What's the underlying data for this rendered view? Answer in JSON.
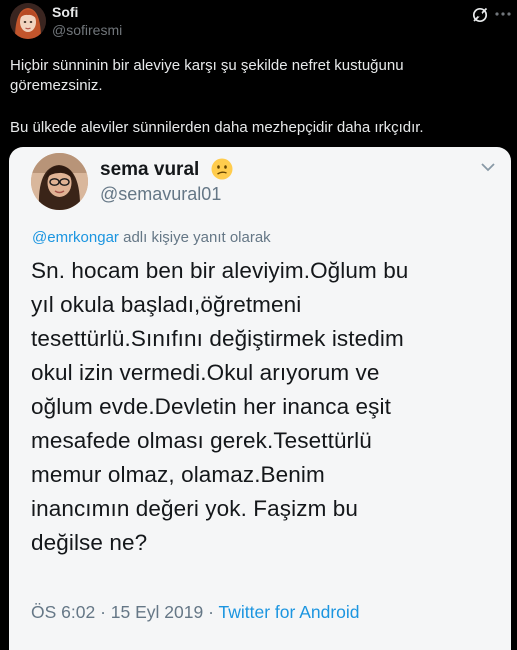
{
  "post": {
    "author_name": "Sofi",
    "author_handle": "@sofiresmi",
    "text_line_1": "Hiçbir sünninin bir aleviye karşı şu şekilde nefret kustuğunu",
    "text_line_2": "göremezsiniz.",
    "text_line_3": "Bu ülkede aleviler sünnilerden daha mezhepçidir daha ırkçıdır."
  },
  "quoted_tweet": {
    "display_name": "sema vural",
    "handle": "@semavural01",
    "reply_mention": "@emrkongar",
    "reply_suffix": "adlı kişiye yanıt olarak",
    "body_lines": [
      "Sn. hocam ben bir aleviyim.Oğlum bu",
      "yıl okula başladı,öğretmeni",
      "tesettürlü.Sınıfını değiştirmek istedim",
      "okul izin vermedi.Okul arıyorum ve",
      "oğlum evde.Devletin her inanca eşit",
      "mesafede olması gerek.Tesettürlü",
      "memur olmaz, olamaz.Benim",
      "inancımın değeri yok. Faşizm bu",
      "değilse ne?"
    ],
    "time": "ÖS 6:02",
    "date": "15 Eyl 2019",
    "separator": "·",
    "client": "Twitter for Android"
  },
  "icons": {
    "grok": "grok-icon",
    "more": "more-icon",
    "emoji": "confused-face-emoji",
    "chevron": "chevron-down-icon"
  },
  "colors": {
    "background": "#000000",
    "text_primary": "#e7e9ea",
    "text_secondary": "#71767b",
    "quote_background": "#f5f6f7",
    "quote_link": "#1b95e0"
  }
}
